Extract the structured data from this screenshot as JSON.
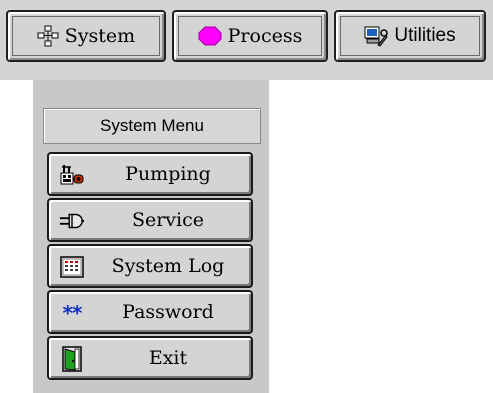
{
  "tabs": [
    {
      "label": "System",
      "icon": "network-icon"
    },
    {
      "label": "Process",
      "icon": "magenta-octagon-icon",
      "icon_color": "#ff00ff"
    },
    {
      "label": "Utilities",
      "icon": "utilities-icon"
    }
  ],
  "panel": {
    "title": "System Menu",
    "items": [
      {
        "label": "Pumping",
        "icon": "pump-icon"
      },
      {
        "label": "Service",
        "icon": "plug-icon"
      },
      {
        "label": "System Log",
        "icon": "log-screen-icon"
      },
      {
        "label": "Password",
        "icon": "asterisks-icon",
        "icon_text": "**",
        "icon_color": "#1030c0"
      },
      {
        "label": "Exit",
        "icon": "door-icon"
      }
    ]
  }
}
